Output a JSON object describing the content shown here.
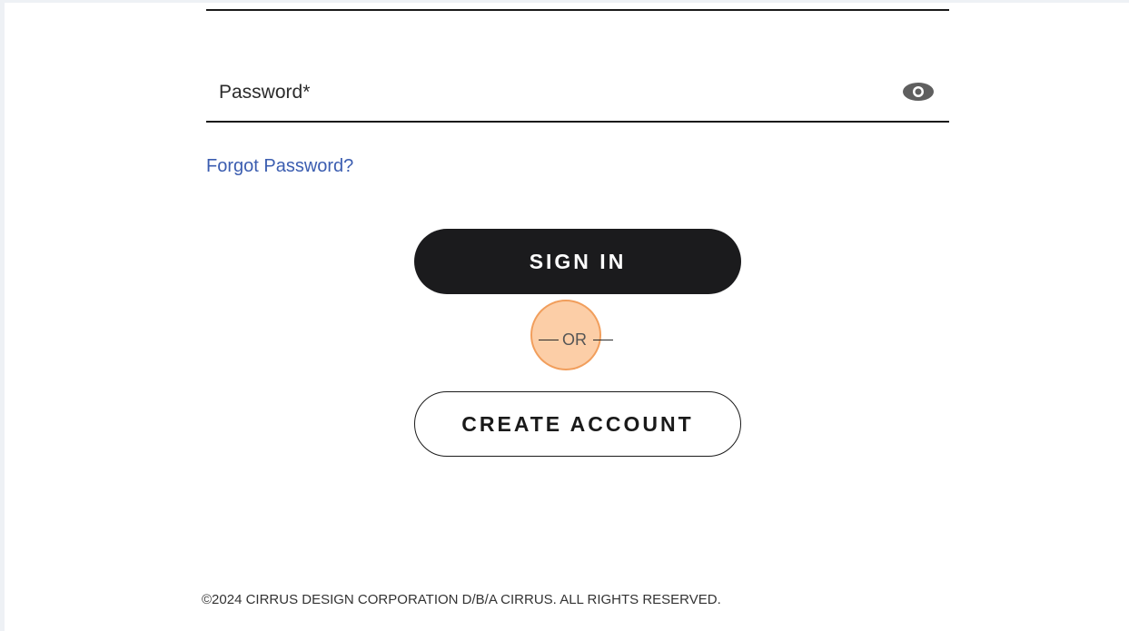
{
  "form": {
    "password": {
      "label": "Password*",
      "toggle_icon": "eye-icon"
    },
    "forgot_password": "Forgot Password?",
    "sign_in_label": "SIGN IN",
    "divider_text": "OR",
    "create_account_label": "CREATE ACCOUNT"
  },
  "footer": {
    "copyright": "©2024 CIRRUS DESIGN CORPORATION D/B/A CIRRUS. ALL RIGHTS RESERVED."
  },
  "colors": {
    "primary_button": "#1b1b1d",
    "link": "#3b5db0",
    "highlight": "#f9b77a"
  }
}
